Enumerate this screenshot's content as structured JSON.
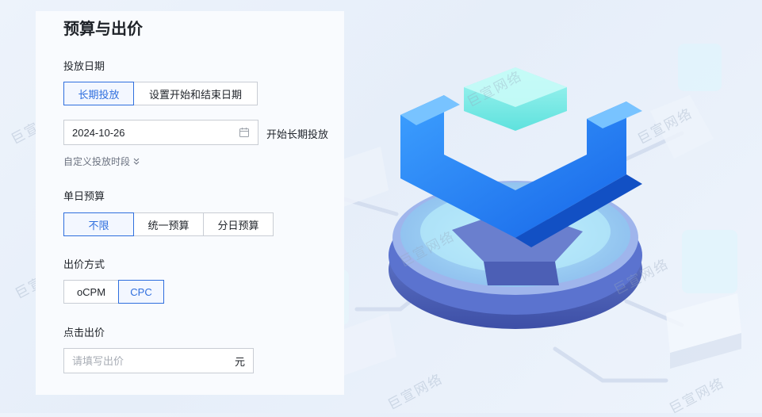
{
  "panel": {
    "title": "预算与出价",
    "schedule": {
      "label": "投放日期",
      "options": [
        "长期投放",
        "设置开始和结束日期"
      ],
      "selected": "长期投放",
      "date_value": "2024-10-26",
      "side_text": "开始长期投放",
      "custom_link": "自定义投放时段"
    },
    "budget": {
      "label": "单日预算",
      "options": [
        "不限",
        "统一预算",
        "分日预算"
      ],
      "selected": "不限"
    },
    "bid_method": {
      "label": "出价方式",
      "options": [
        "oCPM",
        "CPC"
      ],
      "selected": "CPC"
    },
    "click_bid": {
      "label": "点击出价",
      "placeholder": "请填写出价",
      "unit": "元"
    }
  },
  "watermark": "巨宣网络",
  "colors": {
    "accent": "#2f6fde",
    "border": "#c9cdd4",
    "text": "#1f2329",
    "panel_bg": "#f9fbfe"
  }
}
